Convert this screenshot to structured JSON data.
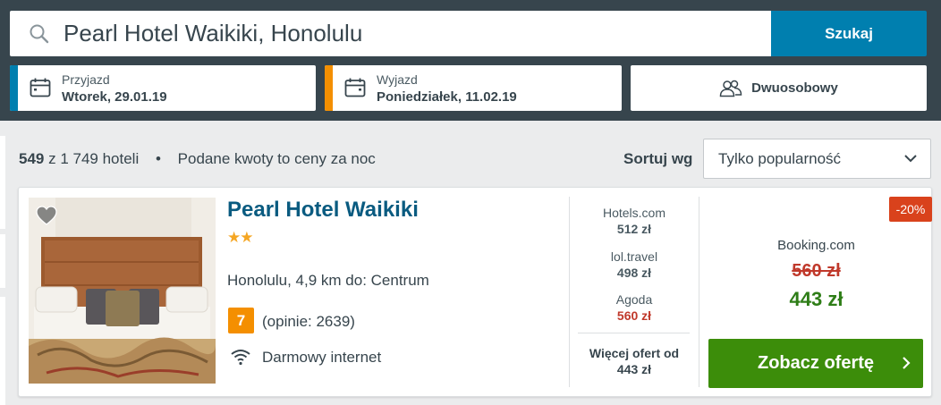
{
  "search": {
    "value": "Pearl Hotel Waikiki, Honolulu",
    "button_label": "Szukaj",
    "icon": "search-icon"
  },
  "checkin": {
    "label": "Przyjazd",
    "value": "Wtorek, 29.01.19",
    "accent": "#007faf",
    "icon": "calendar-icon"
  },
  "checkout": {
    "label": "Wyjazd",
    "value": "Poniedziałek, 11.02.19",
    "accent": "#f48f00",
    "icon": "calendar-icon"
  },
  "room": {
    "label": "Dwuosobowy",
    "icon": "users-icon"
  },
  "results": {
    "count": "549",
    "total_text": "z 1 749 hoteli",
    "separator": "•",
    "note": "Podane kwoty to ceny za noc"
  },
  "sort": {
    "label": "Sortuj wg",
    "selected": "Tylko popularność"
  },
  "hotel": {
    "name": "Pearl Hotel Waikiki",
    "stars": "★★",
    "location": "Honolulu, 4,9 km do: Centrum",
    "rating": "7",
    "reviews": "(opinie: 2639)",
    "amenity": "Darmowy internet",
    "offers": [
      {
        "provider": "Hotels.com",
        "price": "512 zł"
      },
      {
        "provider": "lol.travel",
        "price": "498 zł"
      },
      {
        "provider": "Agoda",
        "price": "560 zł"
      }
    ],
    "more_offers_label": "Więcej ofert od",
    "more_offers_price": "443 zł",
    "discount": "-20%",
    "deal_provider": "Booking.com",
    "old_price": "560 zł",
    "new_price": "443 zł",
    "cta_label": "Zobacz ofertę"
  },
  "colors": {
    "topbar": "#37454d",
    "search_button": "#007faf",
    "cta": "#3c8d0a",
    "hotel_name": "#0a5b80",
    "discount": "#d9421c",
    "rating": "#f48f00",
    "new_price": "#2e7d17",
    "old_price": "#c0392b"
  }
}
